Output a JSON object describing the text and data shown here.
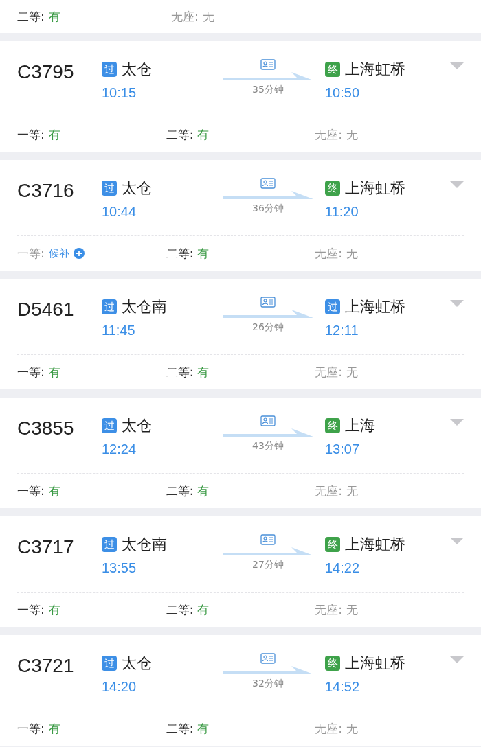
{
  "partial_card": {
    "seats": [
      {
        "label": "二等:",
        "value": "有",
        "kind": "available"
      },
      {
        "label": "无座:",
        "value": "无",
        "kind": "none"
      }
    ]
  },
  "trains": [
    {
      "number": "C3795",
      "from": {
        "badge": "过",
        "kind": "pass",
        "station": "太仓",
        "time": "10:15"
      },
      "duration": "35分钟",
      "to": {
        "badge": "终",
        "kind": "end",
        "station": "上海虹桥",
        "time": "10:50"
      },
      "seats": [
        {
          "label": "一等:",
          "value": "有",
          "kind": "available"
        },
        {
          "label": "二等:",
          "value": "有",
          "kind": "available"
        },
        {
          "label": "无座:",
          "value": "无",
          "kind": "none"
        }
      ]
    },
    {
      "number": "C3716",
      "from": {
        "badge": "过",
        "kind": "pass",
        "station": "太仓",
        "time": "10:44"
      },
      "duration": "36分钟",
      "to": {
        "badge": "终",
        "kind": "end",
        "station": "上海虹桥",
        "time": "11:20"
      },
      "seats": [
        {
          "label": "一等:",
          "value": "候补",
          "kind": "waitlist"
        },
        {
          "label": "二等:",
          "value": "有",
          "kind": "available"
        },
        {
          "label": "无座:",
          "value": "无",
          "kind": "none"
        }
      ]
    },
    {
      "number": "D5461",
      "from": {
        "badge": "过",
        "kind": "pass",
        "station": "太仓南",
        "time": "11:45"
      },
      "duration": "26分钟",
      "to": {
        "badge": "过",
        "kind": "pass",
        "station": "上海虹桥",
        "time": "12:11"
      },
      "seats": [
        {
          "label": "一等:",
          "value": "有",
          "kind": "available"
        },
        {
          "label": "二等:",
          "value": "有",
          "kind": "available"
        },
        {
          "label": "无座:",
          "value": "无",
          "kind": "none"
        }
      ]
    },
    {
      "number": "C3855",
      "from": {
        "badge": "过",
        "kind": "pass",
        "station": "太仓",
        "time": "12:24"
      },
      "duration": "43分钟",
      "to": {
        "badge": "终",
        "kind": "end",
        "station": "上海",
        "time": "13:07"
      },
      "seats": [
        {
          "label": "一等:",
          "value": "有",
          "kind": "available"
        },
        {
          "label": "二等:",
          "value": "有",
          "kind": "available"
        },
        {
          "label": "无座:",
          "value": "无",
          "kind": "none"
        }
      ]
    },
    {
      "number": "C3717",
      "from": {
        "badge": "过",
        "kind": "pass",
        "station": "太仓南",
        "time": "13:55"
      },
      "duration": "27分钟",
      "to": {
        "badge": "终",
        "kind": "end",
        "station": "上海虹桥",
        "time": "14:22"
      },
      "seats": [
        {
          "label": "一等:",
          "value": "有",
          "kind": "available"
        },
        {
          "label": "二等:",
          "value": "有",
          "kind": "available"
        },
        {
          "label": "无座:",
          "value": "无",
          "kind": "none"
        }
      ]
    },
    {
      "number": "C3721",
      "from": {
        "badge": "过",
        "kind": "pass",
        "station": "太仓",
        "time": "14:20"
      },
      "duration": "32分钟",
      "to": {
        "badge": "终",
        "kind": "end",
        "station": "上海虹桥",
        "time": "14:52"
      },
      "seats": [
        {
          "label": "一等:",
          "value": "有",
          "kind": "available"
        },
        {
          "label": "二等:",
          "value": "有",
          "kind": "available"
        },
        {
          "label": "无座:",
          "value": "无",
          "kind": "none"
        }
      ]
    }
  ]
}
